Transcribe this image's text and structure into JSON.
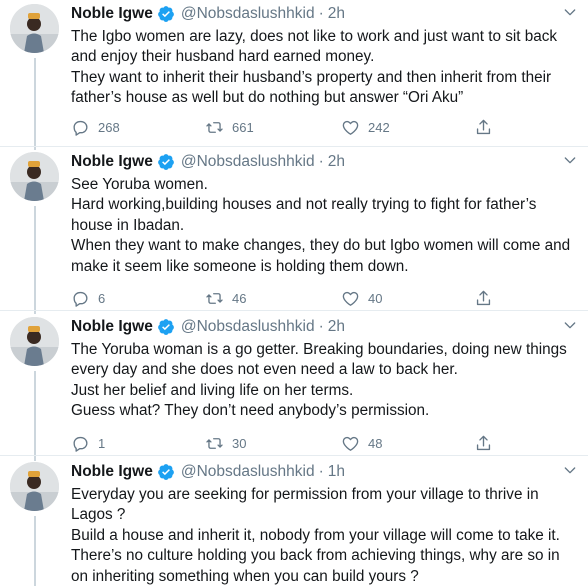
{
  "tweets": [
    {
      "name": "Noble Igwe",
      "handle": "@Nobsdaslushhkid",
      "separator": "·",
      "time": "2h",
      "text": "The Igbo women are lazy, does not like to work and just want to sit back and enjoy their husband hard earned money.\nThey want to inherit their husband’s property and then inherit from their father’s house as well but do nothing but answer “Ori Aku”",
      "replies": "268",
      "retweets": "661",
      "likes": "242"
    },
    {
      "name": "Noble Igwe",
      "handle": "@Nobsdaslushhkid",
      "separator": "·",
      "time": "2h",
      "text": "See Yoruba women.\nHard working,building houses and not really trying to fight for father’s house in Ibadan.\nWhen they want to make changes, they do but Igbo women will come and make it seem like someone is holding them down.",
      "replies": "6",
      "retweets": "46",
      "likes": "40"
    },
    {
      "name": "Noble Igwe",
      "handle": "@Nobsdaslushhkid",
      "separator": "·",
      "time": "2h",
      "text": "The Yoruba woman is a go getter. Breaking boundaries, doing new things every day and she does not even need a law to back her.\nJust her belief and living life on her terms.\nGuess what? They don’t need anybody’s permission.",
      "replies": "1",
      "retweets": "30",
      "likes": "48"
    },
    {
      "name": "Noble Igwe",
      "handle": "@Nobsdaslushhkid",
      "separator": "·",
      "time": "1h",
      "text": "Everyday you are seeking for permission from your village to thrive in Lagos ?\nBuild a house and inherit it, nobody from your village will come to take it.\nThere’s no culture holding you back from achieving things, why are so in on inheriting something when you can build yours ?"
    }
  ],
  "colors": {
    "verified": "#1da1f2",
    "secondary_text": "#657786",
    "thread_line": "#ccd6dd",
    "divider": "#e6ecf0"
  },
  "icons": [
    "verified-badge-icon",
    "chevron-down-icon",
    "reply-icon",
    "retweet-icon",
    "like-icon",
    "share-icon"
  ]
}
